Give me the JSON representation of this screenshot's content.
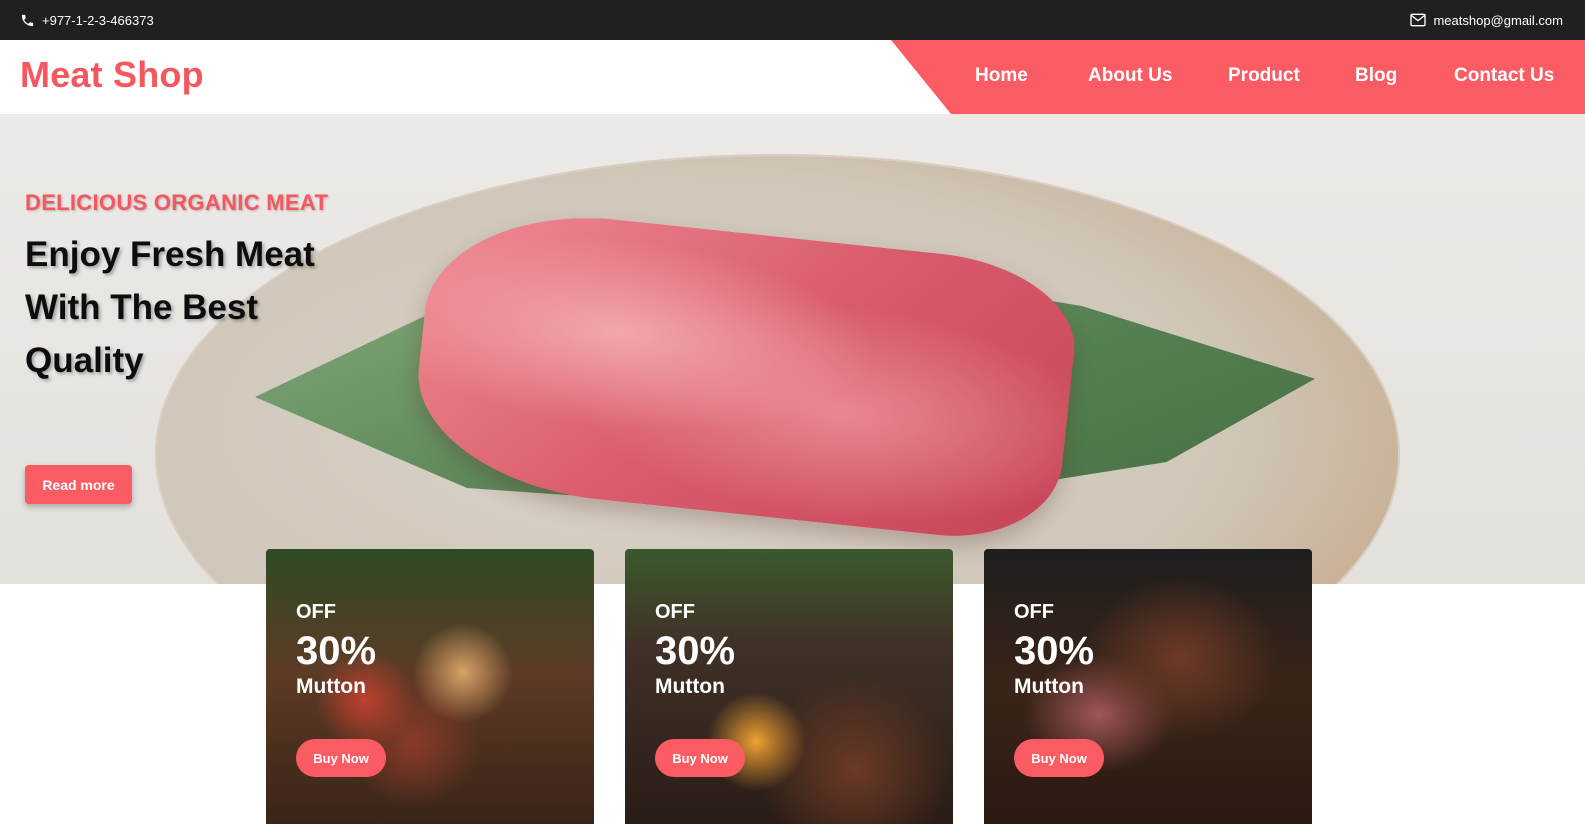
{
  "topbar": {
    "phone": "+977-1-2-3-466373",
    "email": "meatshop@gmail.com",
    "phone_icon": "phone-icon",
    "email_icon": "envelope-icon"
  },
  "header": {
    "logo": "Meat Shop",
    "nav": [
      "Home",
      "About Us",
      "Product",
      "Blog",
      "Contact Us"
    ]
  },
  "hero": {
    "subtitle": "DELICIOUS ORGANIC MEAT",
    "title": "Enjoy Fresh Meat With The Best Quality",
    "button": "Read more"
  },
  "offers": [
    {
      "label": "OFF",
      "discount": "30%",
      "item": "Mutton",
      "button": "Buy Now"
    },
    {
      "label": "OFF",
      "discount": "30%",
      "item": "Mutton",
      "button": "Buy Now"
    },
    {
      "label": "OFF",
      "discount": "30%",
      "item": "Mutton",
      "button": "Buy Now"
    }
  ],
  "colors": {
    "accent": "#fb5b63",
    "logo": "#f4585e",
    "topbar": "#231f20"
  }
}
